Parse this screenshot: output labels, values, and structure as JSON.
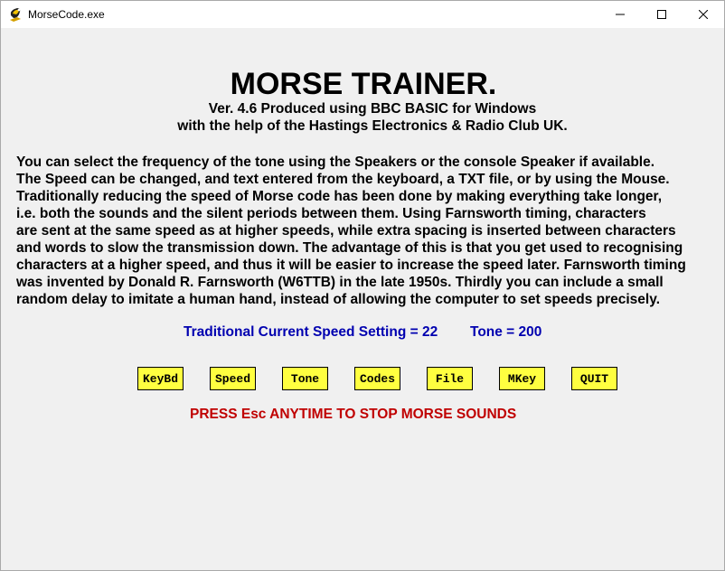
{
  "window": {
    "title": "MorseCode.exe",
    "icon": "bbc-basic-app-icon",
    "controls": [
      "minimize-icon",
      "maximize-icon",
      "close-icon"
    ]
  },
  "header": {
    "title": "MORSE TRAINER.",
    "version_line": "Ver. 4.6  Produced using BBC BASIC for Windows",
    "credit_line": "with the help of the Hastings Electronics & Radio Club UK."
  },
  "description": [
    "You can select the frequency of the tone using the Speakers or the console Speaker if available.",
    "The Speed can be changed, and text entered from the keyboard, a TXT file, or by using the Mouse.",
    "Traditionally reducing the speed of Morse code has been done by making everything take longer,",
    "i.e. both the sounds and the silent periods between them. Using Farnsworth timing, characters",
    "are sent at the same speed as at higher speeds, while extra spacing is inserted between characters",
    "and words to slow the transmission down. The advantage of this is that you get used to recognising",
    "characters at a higher speed, and thus it will be easier to increase the speed later. Farnsworth timing",
    "was invented by Donald R. Farnsworth (W6TTB) in the late 1950s. Thirdly you can include a small",
    "random delay to imitate a human hand, instead of allowing the computer to set speeds precisely."
  ],
  "status": {
    "speed_text": "Traditional Current Speed Setting = 22",
    "tone_text": "Tone = 200"
  },
  "buttons": [
    "KeyBd",
    "Speed",
    "Tone",
    "Codes",
    "File",
    "MKey",
    "QUIT"
  ],
  "warning": "PRESS Esc ANYTIME TO STOP MORSE SOUNDS",
  "colors": {
    "status_text": "#0000b0",
    "warning_text": "#c00000",
    "button_bg": "#ffff40",
    "window_bg": "#f0f0f0"
  }
}
